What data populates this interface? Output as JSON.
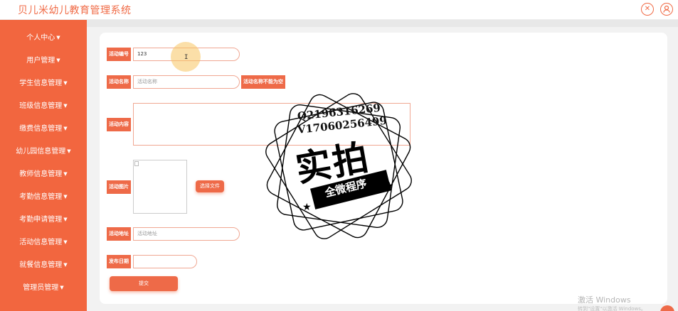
{
  "app": {
    "title": "贝儿米幼儿教育管理系统"
  },
  "topbar": {
    "fullscreen_icon": "fullscreen-icon",
    "user_icon": "user-icon"
  },
  "sidebar": {
    "items": [
      {
        "label": "个人中心"
      },
      {
        "label": "用户管理"
      },
      {
        "label": "学生信息管理"
      },
      {
        "label": "班级信息管理"
      },
      {
        "label": "缴费信息管理"
      },
      {
        "label": "幼儿园信息管理"
      },
      {
        "label": "教师信息管理"
      },
      {
        "label": "考勤信息管理"
      },
      {
        "label": "考勤申请管理"
      },
      {
        "label": "活动信息管理"
      },
      {
        "label": "就餐信息管理"
      },
      {
        "label": "管理员管理"
      }
    ]
  },
  "form": {
    "activity_no": {
      "label": "活动编号",
      "value": "123"
    },
    "activity_name": {
      "label": "活动名称",
      "placeholder": "活动名称",
      "error": "活动名称不能为空"
    },
    "activity_content": {
      "label": "活动内容"
    },
    "activity_image": {
      "label": "活动图片",
      "button": "选择文件"
    },
    "activity_address": {
      "label": "活动地址",
      "placeholder": "活动地址"
    },
    "publish_date": {
      "label": "发布日期"
    },
    "submit": "提交"
  },
  "watermark": {
    "line1": "Q2196316269",
    "line2": "V17060256499",
    "big": "实拍",
    "banner": "全微程序"
  },
  "windows": {
    "activate_title": "激活 Windows",
    "activate_sub": "转到\"设置\"以激活 Windows。"
  },
  "colors": {
    "accent": "#ee6a48",
    "sidebar": "#f2663f"
  }
}
